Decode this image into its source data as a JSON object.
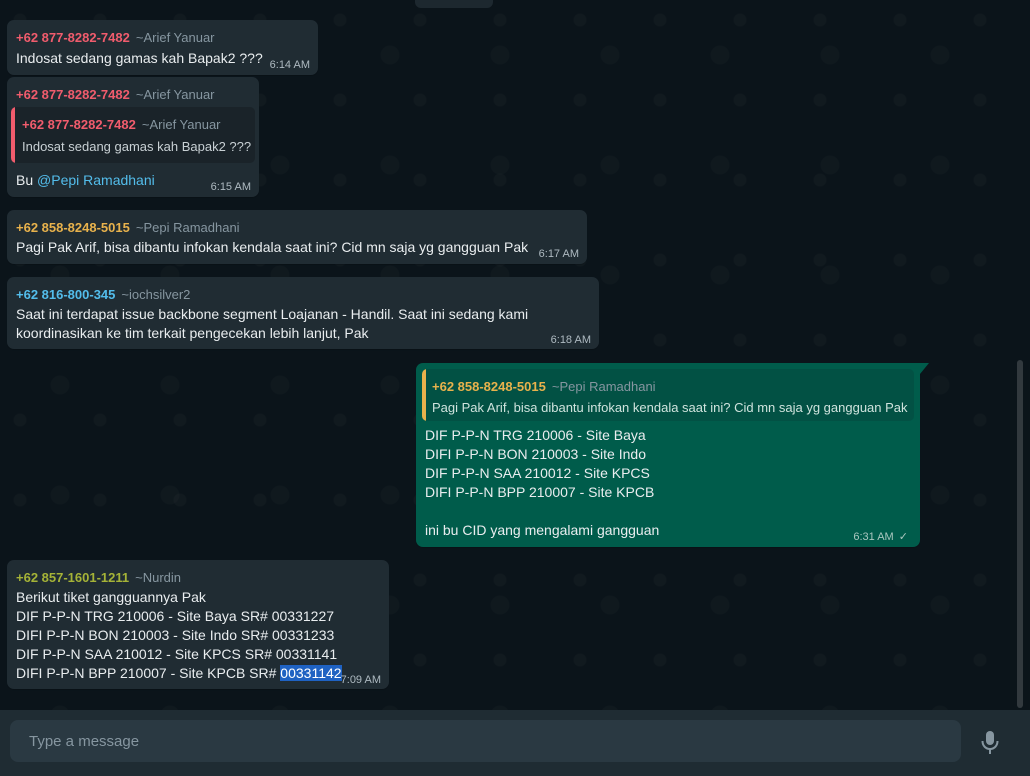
{
  "colors": {
    "phone_red": "#f15c6d",
    "phone_yellow": "#e8b24c",
    "phone_blue": "#53bdeb",
    "phone_olive": "#a5b337",
    "outgoing": "#005c4b",
    "incoming": "#202c33"
  },
  "messages": [
    {
      "phone": "+62 877-8282-7482",
      "name": "~Arief Yanuar",
      "lines": [
        "Indosat sedang gamas kah Bapak2 ???"
      ],
      "time": "6:14 AM"
    },
    {
      "phone": "+62 877-8282-7482",
      "name": "~Arief Yanuar",
      "quote": {
        "phone": "+62 877-8282-7482",
        "name": "~Arief Yanuar",
        "text": "Indosat sedang gamas kah Bapak2 ???"
      },
      "text_prefix": "Bu ",
      "mention": "@Pepi Ramadhani",
      "time": "6:15 AM"
    },
    {
      "phone": "+62 858-8248-5015",
      "name": "~Pepi Ramadhani",
      "lines": [
        "Pagi Pak Arif, bisa dibantu infokan kendala saat ini? Cid mn saja yg gangguan Pak"
      ],
      "time": "6:17 AM"
    },
    {
      "phone": "+62 816-800-345",
      "name": "~iochsilver2",
      "lines": [
        "Saat ini terdapat issue backbone segment Loajanan - Handil. Saat ini sedang kami",
        "koordinasikan ke tim terkait pengecekan lebih lanjut, Pak"
      ],
      "time": "6:18 AM"
    },
    {
      "outgoing": true,
      "quote": {
        "phone": "+62 858-8248-5015",
        "name": "~Pepi Ramadhani",
        "text": "Pagi Pak Arif, bisa dibantu infokan kendala saat ini? Cid mn saja yg gangguan Pak"
      },
      "lines": [
        "DIF P-P-N TRG 210006 - Site Baya",
        "DIFI P-P-N BON 210003 - Site Indo",
        "DIF P-P-N SAA 210012 - Site KPCS",
        "DIFI P-P-N BPP 210007 - Site KPCB",
        "",
        "ini bu CID yang mengalami gangguan"
      ],
      "time": "6:31 AM",
      "status": "✓"
    },
    {
      "phone": "+62 857-1601-1211",
      "name": "~Nurdin",
      "lines": [
        "Berikut tiket gangguannya Pak",
        "DIF P-P-N TRG 210006 - Site Baya SR# 00331227",
        "DIFI P-P-N BON 210003 - Site Indo SR# 00331233",
        "DIF P-P-N SAA 210012 - Site KPCS  SR# 00331141"
      ],
      "last_line_prefix": "DIFI P-P-N BPP 210007 - Site KPCB SR# ",
      "last_line_selected": "00331142",
      "time": "7:09 AM"
    }
  ],
  "composer": {
    "placeholder": "Type a message",
    "mic_icon": "microphone-icon"
  }
}
